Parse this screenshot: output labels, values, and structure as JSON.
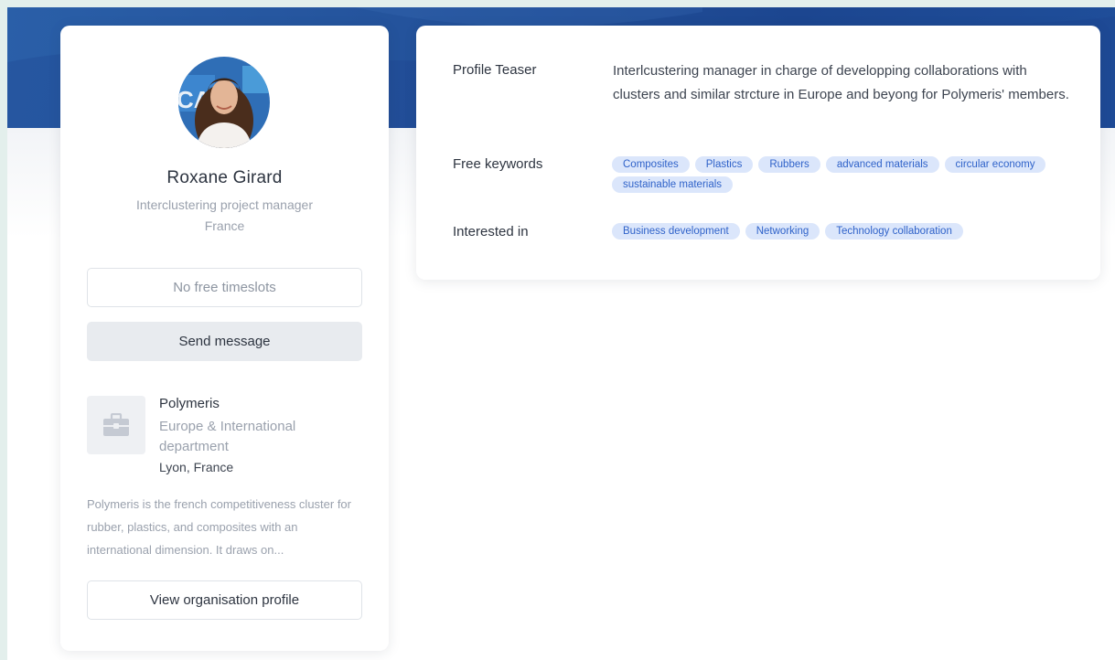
{
  "profile": {
    "name": "Roxane Girard",
    "role": "Interclustering project manager",
    "country": "France"
  },
  "actions": {
    "timeslots_label": "No free timeslots",
    "send_message_label": "Send message",
    "view_org_label": "View organisation profile"
  },
  "organisation": {
    "name": "Polymeris",
    "department": "Europe & International department",
    "location": "Lyon, France",
    "description": "Polymeris is the french competitiveness cluster for rubber, plastics, and composites with an international dimension. It draws on...",
    "logo_icon": "briefcase-icon"
  },
  "details": {
    "teaser_label": "Profile Teaser",
    "teaser_text": "Interlcustering manager in charge of developping collaborations with clusters and similar strcture in Europe and beyong for Polymeris' members.",
    "keywords_label": "Free keywords",
    "keywords": [
      "Composites",
      "Plastics",
      "Rubbers",
      "advanced materials",
      "circular economy",
      "sustainable materials"
    ],
    "interested_label": "Interested in",
    "interests": [
      "Business development",
      "Networking",
      "Technology collaboration"
    ]
  },
  "colors": {
    "banner": "#24539c",
    "tag_bg": "#dbe6fb",
    "tag_text": "#2f62c9"
  }
}
